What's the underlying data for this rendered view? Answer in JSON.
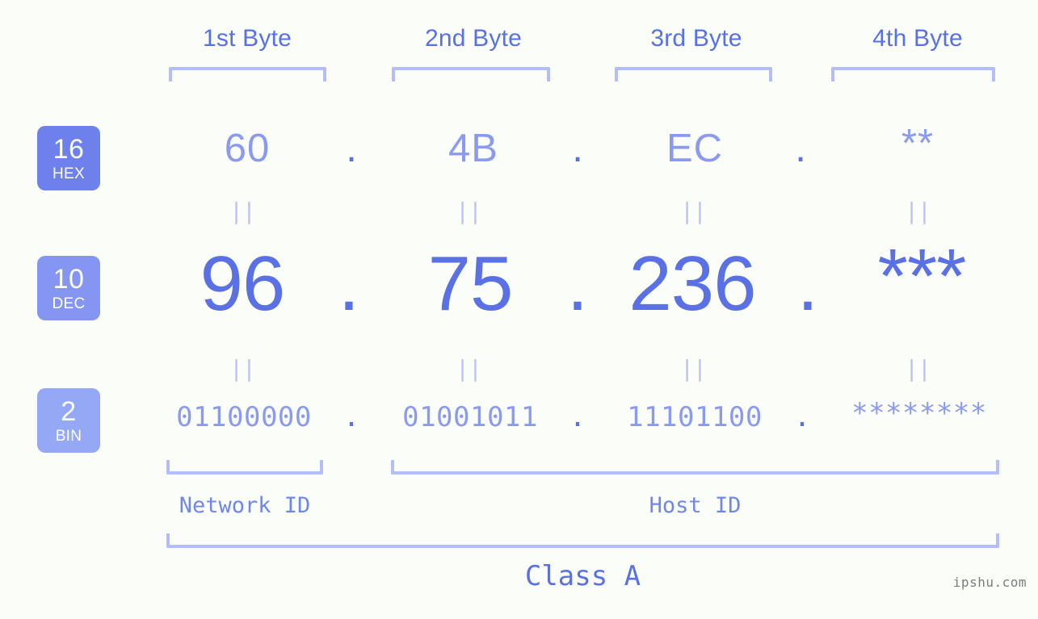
{
  "meta": {
    "watermark": "ipshu.com",
    "background_color": "#fbfdf8",
    "accent_strong": "#5a71e6",
    "accent_light": "#8a9af0",
    "bracket_color": "#b3bdf7"
  },
  "headers": [
    {
      "label": "1st Byte"
    },
    {
      "label": "2nd Byte"
    },
    {
      "label": "3rd Byte"
    },
    {
      "label": "4th Byte"
    }
  ],
  "radix_badges": [
    {
      "number": "16",
      "name": "HEX",
      "color": "#6d80ec"
    },
    {
      "number": "10",
      "name": "DEC",
      "color": "#8496f1"
    },
    {
      "number": "2",
      "name": "BIN",
      "color": "#94a8f5"
    }
  ],
  "rows": {
    "hex": {
      "values": [
        "60",
        "4B",
        "EC",
        "**"
      ],
      "separator": "."
    },
    "dec": {
      "values": [
        "96",
        "75",
        "236",
        "***"
      ],
      "separator": "."
    },
    "bin": {
      "values": [
        "01100000",
        "01001011",
        "11101100",
        "********"
      ],
      "separator": "."
    }
  },
  "equals_marks": [
    "||",
    "||",
    "||",
    "||",
    "||",
    "||",
    "||",
    "||"
  ],
  "sections": {
    "network_id": "Network ID",
    "host_id": "Host ID",
    "class": "Class A"
  }
}
